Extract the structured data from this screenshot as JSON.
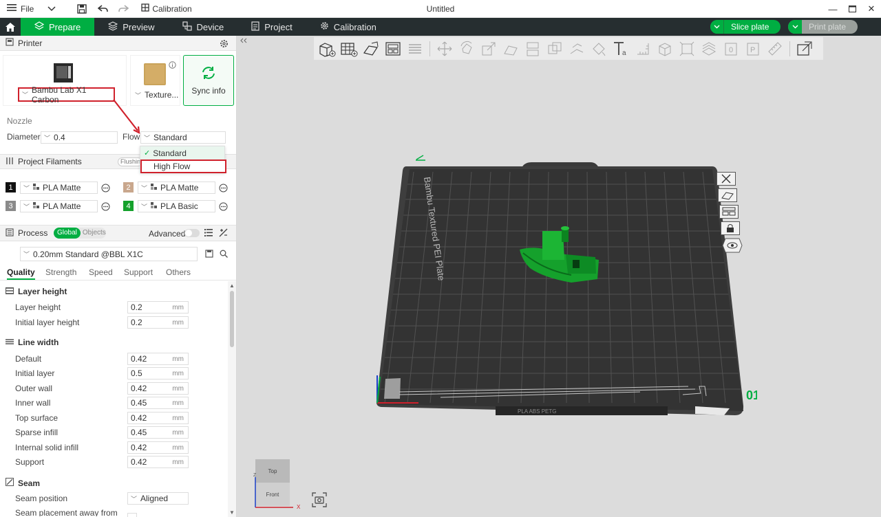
{
  "titlebar": {
    "file_label": "File",
    "calibration_label": "Calibration",
    "window_title": "Untitled"
  },
  "tabs": [
    {
      "label": "Prepare",
      "active": true
    },
    {
      "label": "Preview",
      "active": false
    },
    {
      "label": "Device",
      "active": false
    },
    {
      "label": "Project",
      "active": false
    },
    {
      "label": "Calibration",
      "active": false
    }
  ],
  "actions": {
    "slice_label": "Slice plate",
    "print_label": "Print plate"
  },
  "colors": {
    "accent": "#00ae42",
    "highlight_red": "#d0212c",
    "dark_bar": "#262e30"
  },
  "printer": {
    "section_title": "Printer",
    "model": "Bambu Lab X1 Carbon",
    "plate": "Texture...",
    "sync_label": "Sync info",
    "nozzle_label": "Nozzle",
    "diameter_label": "Diameter",
    "diameter_value": "0.4",
    "flow_label": "Flow",
    "flow_value": "Standard",
    "flow_options": [
      "Standard",
      "High Flow"
    ],
    "flow_selected_index": 0
  },
  "filaments": {
    "section_title": "Project Filaments",
    "flushing_label": "Flushin",
    "items": [
      {
        "num": "1",
        "name": "PLA Matte",
        "color": "#111111"
      },
      {
        "num": "2",
        "name": "PLA Matte",
        "color": "#c9a78d"
      },
      {
        "num": "3",
        "name": "PLA Matte",
        "color": "#8a8a8a"
      },
      {
        "num": "4",
        "name": "PLA Basic",
        "color": "#15a12c"
      }
    ]
  },
  "process": {
    "section_title": "Process",
    "toggle_global": "Global",
    "toggle_objects": "Objects",
    "advanced_label": "Advanced",
    "preset": "0.20mm Standard @BBL X1C",
    "tabs": [
      "Quality",
      "Strength",
      "Speed",
      "Support",
      "Others"
    ],
    "active_tab": "Quality",
    "unit": "mm",
    "layer_group": "Layer height",
    "layer_rows": [
      {
        "label": "Layer height",
        "value": "0.2"
      },
      {
        "label": "Initial layer height",
        "value": "0.2"
      }
    ],
    "width_group": "Line width",
    "width_rows": [
      {
        "label": "Default",
        "value": "0.42"
      },
      {
        "label": "Initial layer",
        "value": "0.5"
      },
      {
        "label": "Outer wall",
        "value": "0.42"
      },
      {
        "label": "Inner wall",
        "value": "0.45"
      },
      {
        "label": "Top surface",
        "value": "0.42"
      },
      {
        "label": "Sparse infill",
        "value": "0.45"
      },
      {
        "label": "Internal solid infill",
        "value": "0.42"
      },
      {
        "label": "Support",
        "value": "0.42"
      }
    ],
    "seam_group": "Seam",
    "seam_position_label": "Seam position",
    "seam_position_value": "Aligned",
    "seam_away_label": "Seam placement away from"
  },
  "viewport": {
    "plate_label": "Bambu Textured PEI Plate",
    "plate_number": "01",
    "plate_footer": "PLA ABS PETG",
    "view_top": "Top",
    "view_front": "Front",
    "axis_z": "Z",
    "axis_x": "X"
  }
}
